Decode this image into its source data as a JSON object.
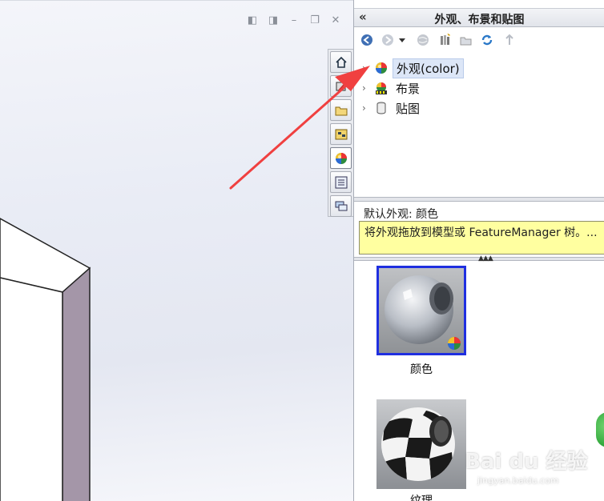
{
  "viewport": {
    "window_controls": [
      "restore-left",
      "restore-right",
      "minimize",
      "maximize",
      "close"
    ]
  },
  "task_tabs": [
    {
      "name": "home",
      "icon": "home-icon"
    },
    {
      "name": "3d-content",
      "icon": "3d-content-icon"
    },
    {
      "name": "file-explorer",
      "icon": "folder-icon"
    },
    {
      "name": "view-palette",
      "icon": "view-palette-icon"
    },
    {
      "name": "appearances",
      "icon": "color-ball-icon",
      "active": true
    },
    {
      "name": "custom-properties",
      "icon": "properties-icon"
    },
    {
      "name": "forum",
      "icon": "chat-icon"
    }
  ],
  "pane": {
    "collapse_glyph": "«",
    "title": "外观、布景和贴图",
    "toolbar": [
      "back-icon",
      "forward-icon",
      "dropdown-icon",
      "world-icon",
      "library-icon",
      "folder-add-icon",
      "refresh-icon",
      "up-icon"
    ],
    "tree": [
      {
        "label": "外观(color)",
        "icon": "color-ball-icon",
        "selected": true
      },
      {
        "label": "布景",
        "icon": "scene-icon",
        "selected": false
      },
      {
        "label": "贴图",
        "icon": "decal-icon",
        "selected": false
      }
    ],
    "info_label": "默认外观: 颜色",
    "tip": "将外观拖放到模型或 FeatureManager 树。...",
    "thumbnails": [
      {
        "label": "颜色",
        "selected": true
      },
      {
        "label": "纹理",
        "selected": false
      }
    ]
  },
  "watermark": {
    "brand": "Bai du 经验",
    "url": "jingyan.baidu.com"
  },
  "colors": {
    "selection_border": "#1f2fe0",
    "tip_background": "#ffffa0",
    "arrow": "#f04040",
    "model_side": "#a496a8"
  }
}
